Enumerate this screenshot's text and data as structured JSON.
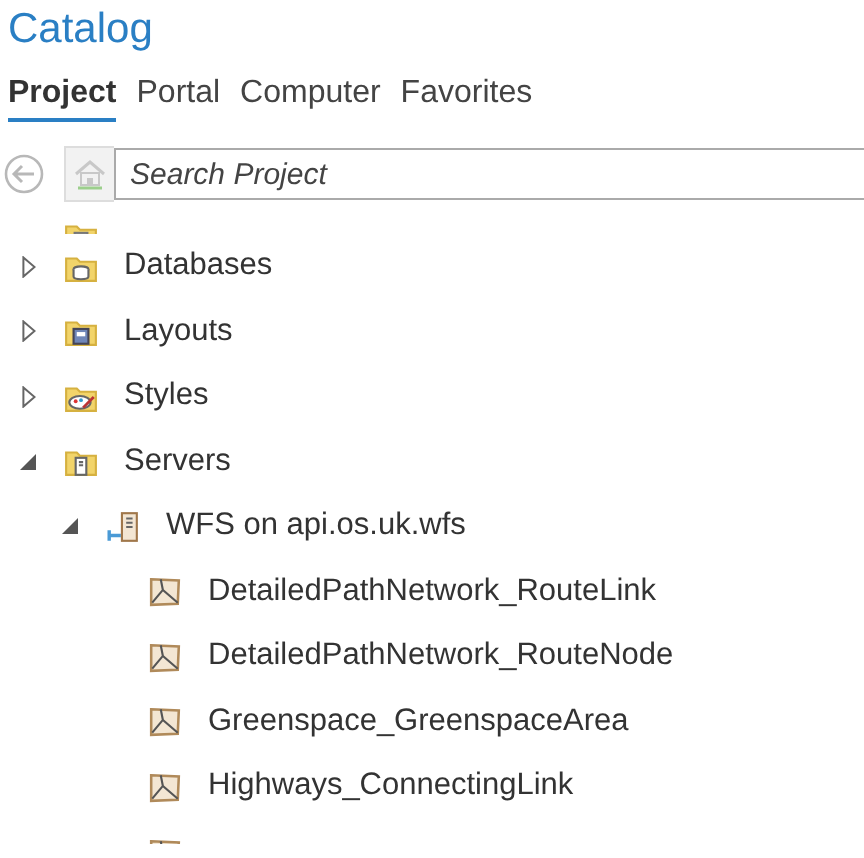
{
  "pane": {
    "title": "Catalog"
  },
  "tabs": [
    {
      "label": "Project",
      "selected": true
    },
    {
      "label": "Portal",
      "selected": false
    },
    {
      "label": "Computer",
      "selected": false
    },
    {
      "label": "Favorites",
      "selected": false
    }
  ],
  "search": {
    "placeholder": "Search Project"
  },
  "tree": [
    {
      "kind": "folder-notebook",
      "cut": true
    },
    {
      "kind": "folder-database",
      "label": "Databases",
      "expanded": false
    },
    {
      "kind": "folder-layout",
      "label": "Layouts",
      "expanded": false
    },
    {
      "kind": "folder-style",
      "label": "Styles",
      "expanded": false
    },
    {
      "kind": "folder-server",
      "label": "Servers",
      "expanded": true,
      "children": [
        {
          "kind": "server",
          "label": "WFS on api.os.uk.wfs",
          "expanded": true,
          "children": [
            {
              "kind": "layer",
              "label": "DetailedPathNetwork_RouteLink"
            },
            {
              "kind": "layer",
              "label": "DetailedPathNetwork_RouteNode"
            },
            {
              "kind": "layer",
              "label": "Greenspace_GreenspaceArea"
            },
            {
              "kind": "layer",
              "label": "Highways_ConnectingLink"
            },
            {
              "kind": "layer",
              "cut": true
            }
          ]
        }
      ]
    }
  ]
}
